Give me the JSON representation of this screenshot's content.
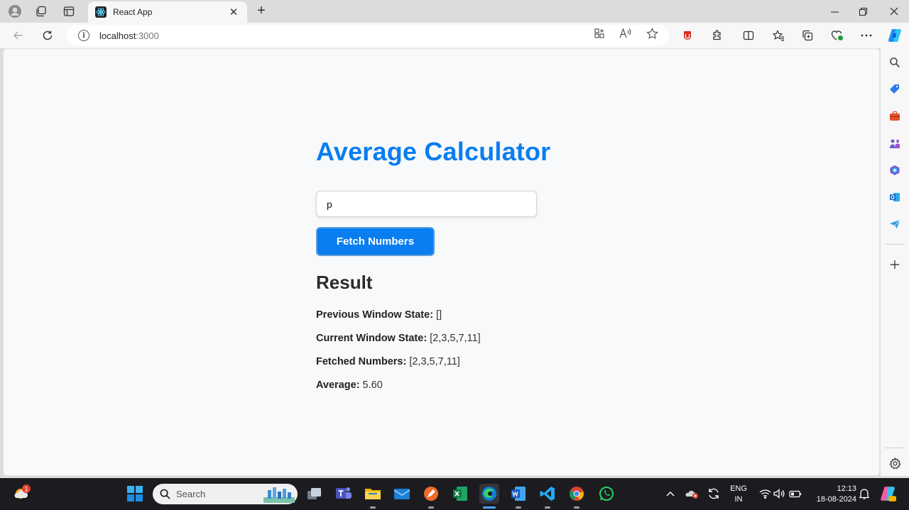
{
  "browser": {
    "tab_title": "React App",
    "url_host": "localhost",
    "url_port": ":3000"
  },
  "app": {
    "heading": "Average Calculator",
    "input_value": "p",
    "fetch_button_label": "Fetch Numbers",
    "result_heading": "Result",
    "rows": [
      {
        "label": "Previous Window State:",
        "value": " []"
      },
      {
        "label": "Current Window State:",
        "value": " [2,3,5,7,11]"
      },
      {
        "label": "Fetched Numbers:",
        "value": " [2,3,5,7,11]"
      },
      {
        "label": "Average:",
        "value": " 5.60"
      }
    ]
  },
  "taskbar": {
    "search_label": "Search",
    "weather_badge": "1",
    "lang_line1": "ENG",
    "lang_line2": "IN",
    "time": "12:13",
    "date": "18-08-2024"
  },
  "colors": {
    "accent": "#0a7df0",
    "page_bg": "#f8f9fb",
    "taskbar_bg": "#1c1c20"
  }
}
